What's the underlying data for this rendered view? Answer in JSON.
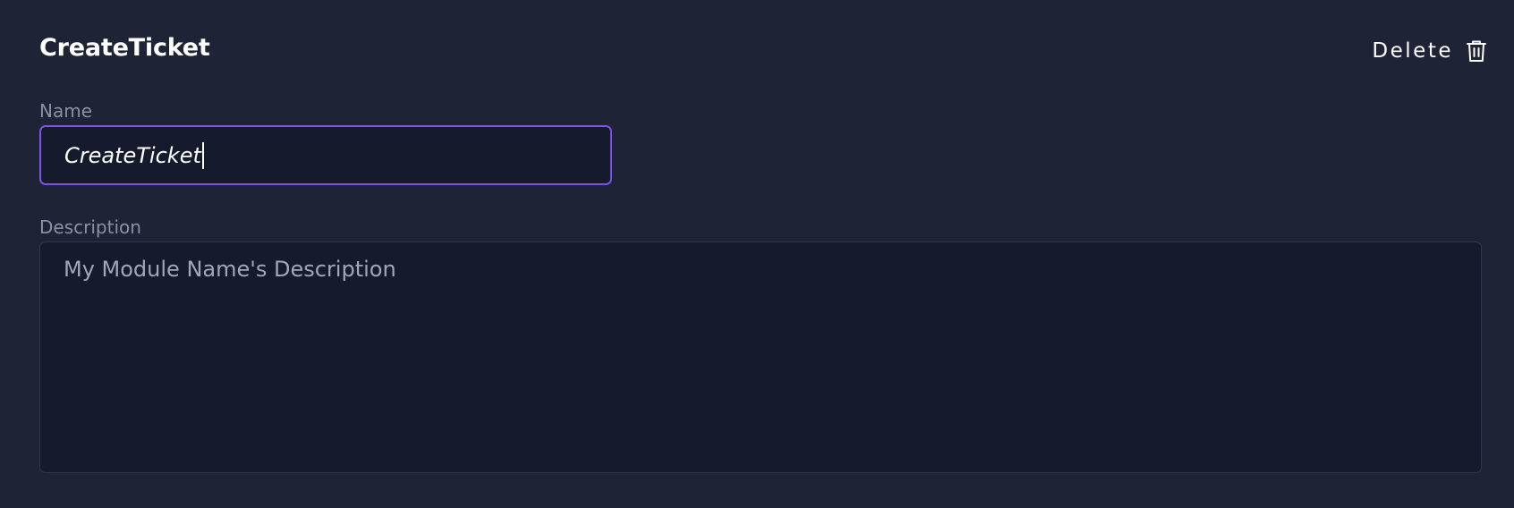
{
  "header": {
    "title": "CreateTicket",
    "delete_label": "Delete",
    "delete_icon": "trash-icon"
  },
  "form": {
    "name": {
      "label": "Name",
      "value": "CreateTicket"
    },
    "description": {
      "label": "Description",
      "placeholder": "My Module Name's Description",
      "value": ""
    }
  },
  "colors": {
    "background": "#1f2336",
    "input_background": "#151a2d",
    "focus_border": "#7b55e6",
    "border": "#31364a",
    "label": "#8b90a6",
    "placeholder": "#a2a6b8"
  }
}
